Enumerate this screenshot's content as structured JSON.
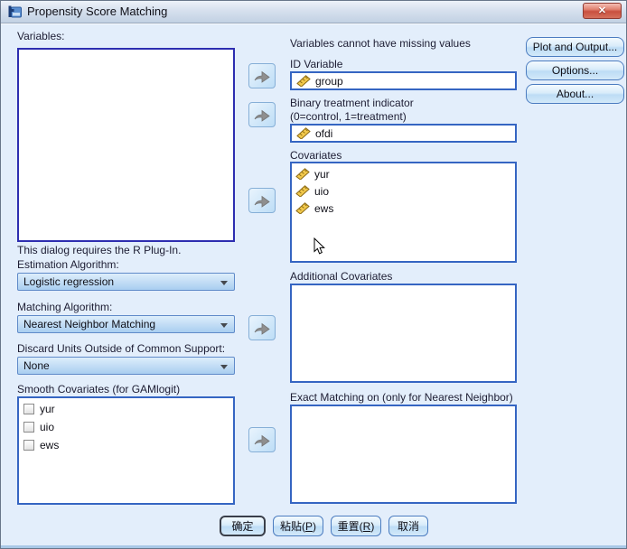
{
  "window": {
    "title": "Propensity Score Matching"
  },
  "icons": {
    "close_glyph": "✕"
  },
  "header_buttons": {
    "plot_output": "Plot and Output...",
    "options": "Options...",
    "about": "About..."
  },
  "left": {
    "variables_label": "Variables:",
    "variables_items": [],
    "r_note": "This dialog requires the R Plug-In.",
    "estimation_label": "Estimation Algorithm:",
    "estimation_value": "Logistic regression",
    "matching_label": "Matching Algorithm:",
    "matching_value": "Nearest Neighbor Matching",
    "discard_label": "Discard Units Outside of Common Support:",
    "discard_value": "None",
    "smooth_label": "Smooth Covariates (for GAMlogit)",
    "smooth_items": [
      {
        "label": "yur",
        "checked": false
      },
      {
        "label": "uio",
        "checked": false
      },
      {
        "label": "ews",
        "checked": false
      }
    ]
  },
  "right": {
    "missing_note": "Variables cannot have missing values",
    "id_label": "ID Variable",
    "id_value": "group",
    "treatment_label": "Binary treatment indicator",
    "treatment_sublabel": "(0=control, 1=treatment)",
    "treatment_value": "ofdi",
    "covariates_label": "Covariates",
    "covariates_items": [
      "yur",
      "uio",
      "ews"
    ],
    "additional_label": "Additional Covariates",
    "additional_items": [],
    "exact_label": "Exact Matching on (only for Nearest Neighbor)",
    "exact_items": []
  },
  "bottom_buttons": {
    "ok": "确定",
    "paste_prefix": "粘贴(",
    "paste_key": "P",
    "paste_suffix": ")",
    "reset_prefix": "重置(",
    "reset_key": "R",
    "reset_suffix": ")",
    "cancel": "取消"
  },
  "colors": {
    "dialog_bg": "#e3eefb",
    "list_border": "#3565c2",
    "variables_list_border": "#2d2db0",
    "button_border": "#4b7cc0",
    "close_red": "#c9503f",
    "scale_icon_gold": "#f2c94c"
  }
}
